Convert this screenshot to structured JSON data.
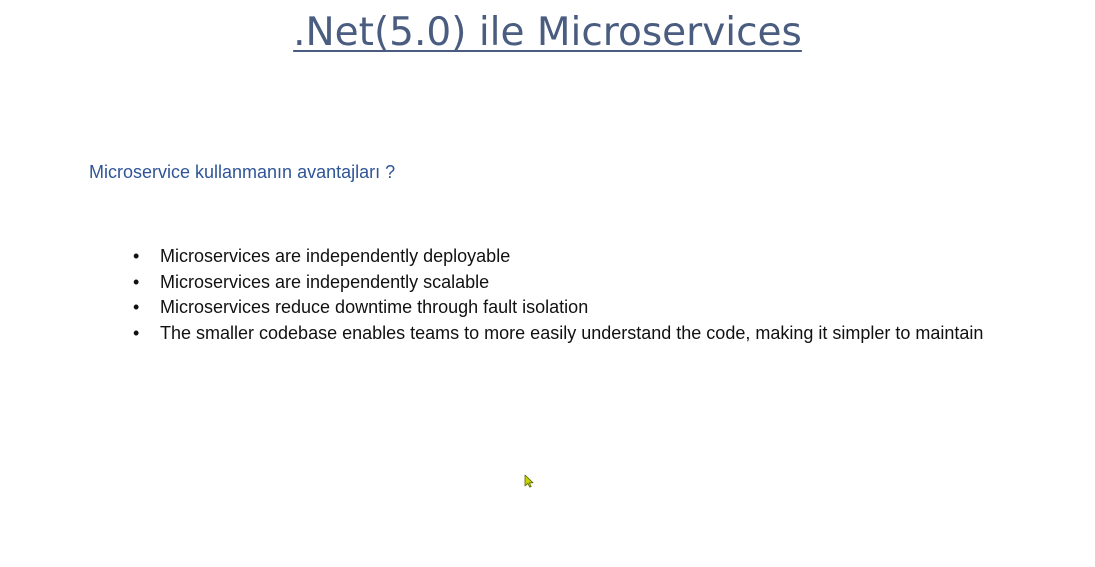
{
  "slide": {
    "title": ".Net(5.0) ile Microservices",
    "subtitle": "Microservice kullanmanın avantajları ?",
    "bullet_marker": "•",
    "bullets": [
      "Microservices are independently deployable",
      "Microservices are independently scalable",
      "Microservices reduce downtime through fault isolation",
      "The smaller codebase enables teams to more easily understand the code, making it simpler to maintain"
    ]
  },
  "colors": {
    "title": "#4a5d80",
    "subtitle": "#2f5597",
    "body_text": "#111111",
    "cursor": "#c8d400"
  },
  "icons": {
    "cursor": "mouse-pointer-icon"
  }
}
